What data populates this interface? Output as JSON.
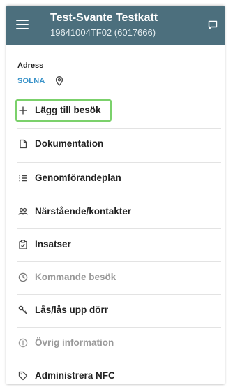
{
  "header": {
    "title": "Test-Svante Testkatt",
    "subtitle": "19641004TF02 (6017666)",
    "bg_color": "#4c6f7d"
  },
  "address": {
    "label": "Adress",
    "value": "SOLNA"
  },
  "menu": {
    "items": [
      {
        "label": "Lägg till besök",
        "icon": "plus-icon",
        "enabled": true
      },
      {
        "label": "Dokumentation",
        "icon": "document-icon",
        "enabled": true
      },
      {
        "label": "Genomförandeplan",
        "icon": "list-icon",
        "enabled": true
      },
      {
        "label": "Närstående/kontakter",
        "icon": "people-icon",
        "enabled": true
      },
      {
        "label": "Insatser",
        "icon": "clipboard-icon",
        "enabled": true
      },
      {
        "label": "Kommande besök",
        "icon": "clock-icon",
        "enabled": false
      },
      {
        "label": "Lås/lås upp dörr",
        "icon": "key-icon",
        "enabled": true
      },
      {
        "label": "Övrig information",
        "icon": "info-icon",
        "enabled": false
      },
      {
        "label": "Administrera NFC",
        "icon": "tag-icon",
        "enabled": true
      }
    ]
  },
  "colors": {
    "accent": "#3a93c9",
    "highlight": "#7bd16b",
    "disabled_text": "#9a9a9a"
  }
}
